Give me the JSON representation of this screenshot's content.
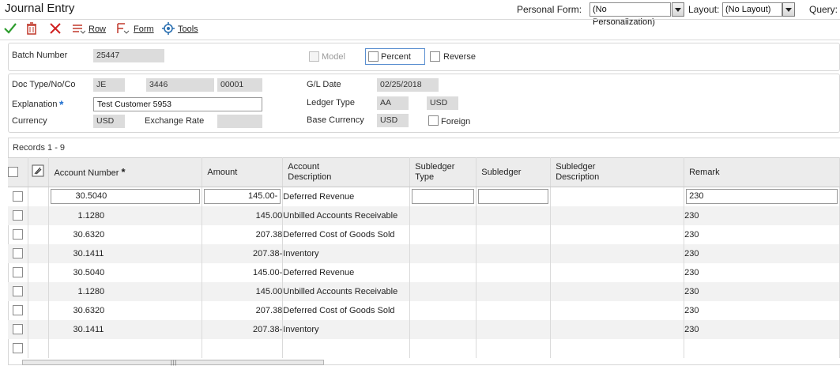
{
  "title": "Journal Entry",
  "header": {
    "personal_form_label": "Personal Form:",
    "personal_form_value": "(No Personalization)",
    "layout_label": "Layout:",
    "layout_value": "(No Layout)",
    "query_label": "Query:"
  },
  "toolbar": {
    "ok_icon": "checkmark-icon",
    "delete_icon": "trash-icon",
    "cancel_icon": "close-icon",
    "row_label": "Row",
    "form_label": "Form",
    "tools_label": "Tools"
  },
  "batch": {
    "batch_number_label": "Batch Number",
    "batch_number": "25447",
    "model_label": "Model",
    "percent_label": "Percent",
    "reverse_label": "Reverse"
  },
  "doc": {
    "doc_label": "Doc Type/No/Co",
    "doc_type": "JE",
    "doc_no": "3446",
    "doc_co": "00001",
    "explanation_label": "Explanation",
    "explanation": "Test Customer 5953",
    "currency_label": "Currency",
    "currency": "USD",
    "exchange_rate_label": "Exchange Rate",
    "exchange_rate": "",
    "gl_date_label": "G/L Date",
    "gl_date": "02/25/2018",
    "ledger_type_label": "Ledger Type",
    "ledger_type": "AA",
    "ledger_currency": "USD",
    "base_currency_label": "Base Currency",
    "base_currency": "USD",
    "foreign_label": "Foreign"
  },
  "grid": {
    "records_label": "Records 1 - 9",
    "columns": {
      "account_number": "Account Number",
      "amount": "Amount",
      "account_description_1": "Account",
      "account_description_2": "Description",
      "subledger_type_1": "Subledger",
      "subledger_type_2": "Type",
      "subledger": "Subledger",
      "subledger_description_1": "Subledger",
      "subledger_description_2": "Description",
      "remark": "Remark"
    },
    "rows": [
      {
        "account": "30.5040",
        "amount": "145.00-",
        "description": "Deferred Revenue",
        "remark": "230"
      },
      {
        "account": "1.1280",
        "amount": "145.00",
        "description": "Unbilled Accounts Receivable",
        "remark": "230"
      },
      {
        "account": "30.6320",
        "amount": "207.38",
        "description": "Deferred Cost of Goods Sold",
        "remark": "230"
      },
      {
        "account": "30.1411",
        "amount": "207.38-",
        "description": "Inventory",
        "remark": "230"
      },
      {
        "account": "30.5040",
        "amount": "145.00-",
        "description": "Deferred Revenue",
        "remark": "230"
      },
      {
        "account": "1.1280",
        "amount": "145.00",
        "description": "Unbilled Accounts Receivable",
        "remark": "230"
      },
      {
        "account": "30.6320",
        "amount": "207.38",
        "description": "Deferred Cost of Goods Sold",
        "remark": "230"
      },
      {
        "account": "30.1411",
        "amount": "207.38-",
        "description": "Inventory",
        "remark": "230"
      },
      {
        "account": "",
        "amount": "",
        "description": "",
        "remark": ""
      }
    ]
  },
  "colors": {
    "ok": "#2e9d2e",
    "delete": "#c0392b",
    "cancel": "#d02020",
    "required": "#1f6fcf"
  }
}
